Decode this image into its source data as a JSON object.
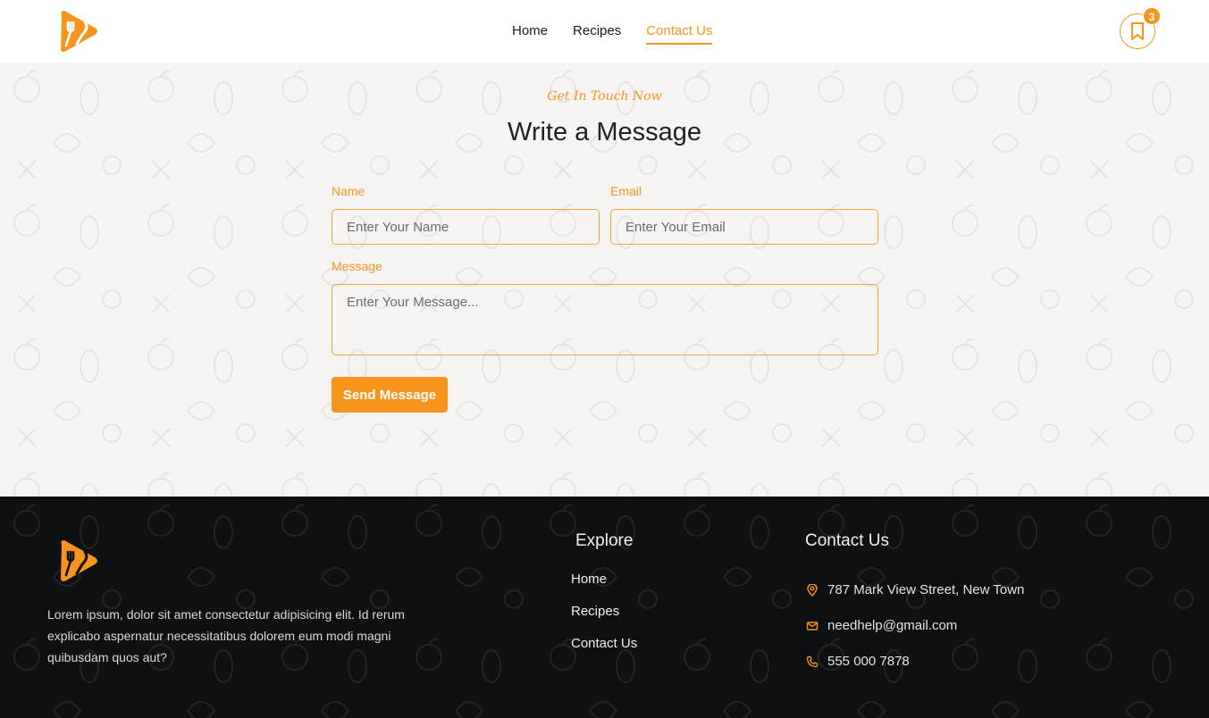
{
  "brand": {
    "logo_icon": "fork-knife-logo-icon",
    "accent_color": "#f7941d"
  },
  "nav": {
    "items": [
      {
        "label": "Home"
      },
      {
        "label": "Recipes"
      },
      {
        "label": "Contact Us",
        "active": true
      }
    ],
    "bookmark_icon": "bookmark-icon",
    "bookmark_count": "3"
  },
  "contact_form": {
    "eyebrow": "Get In Touch Now",
    "title": "Write a Message",
    "name_label": "Name",
    "name_placeholder": "Enter Your Name",
    "email_label": "Email",
    "email_placeholder": "Enter Your Email",
    "message_label": "Message",
    "message_placeholder": "Enter Your Message...",
    "submit_label": "Send Message"
  },
  "footer": {
    "about": "Lorem ipsum, dolor sit amet consectetur adipisicing elit. Id rerum explicabo aspernatur necessitatibus dolorem eum modi magni quibusdam quos aut?",
    "explore_title": "Explore",
    "explore_links": [
      "Home",
      "Recipes",
      "Contact Us"
    ],
    "contact_title": "Contact Us",
    "address": "787 Mark View Street, New Town",
    "email": "needhelp@gmail.com",
    "phone": "555 000 7878",
    "address_icon": "location-pin-icon",
    "email_icon": "envelope-icon",
    "phone_icon": "phone-icon"
  }
}
